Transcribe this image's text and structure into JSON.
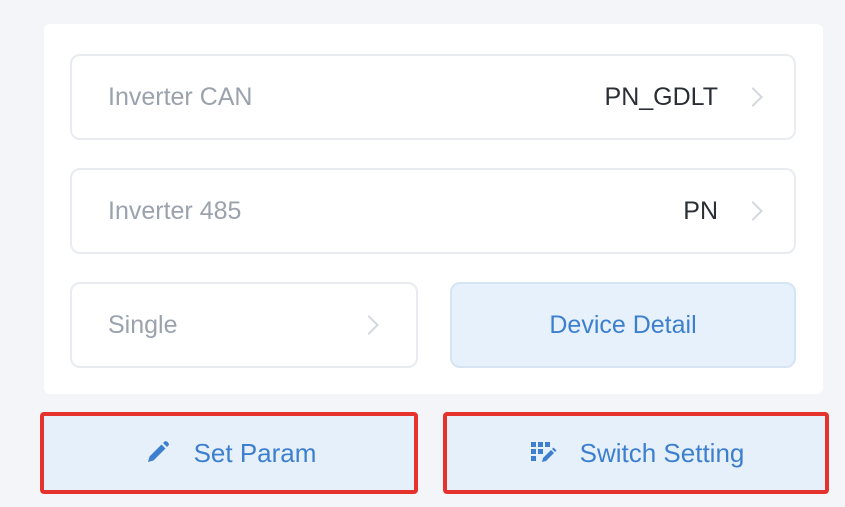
{
  "rows": [
    {
      "label": "Inverter CAN",
      "value": "PN_GDLT"
    },
    {
      "label": "Inverter 485",
      "value": "PN"
    }
  ],
  "single": {
    "label": "Single"
  },
  "device_detail": {
    "label": "Device Detail"
  },
  "actions": {
    "set_param": {
      "label": "Set Param",
      "icon": "pencil-icon"
    },
    "switch_setting": {
      "label": "Switch Setting",
      "icon": "dip-switch-icon"
    }
  },
  "colors": {
    "accent": "#3d7fcf",
    "highlight_border": "#e6322d",
    "button_bg": "#e6f0fb"
  }
}
